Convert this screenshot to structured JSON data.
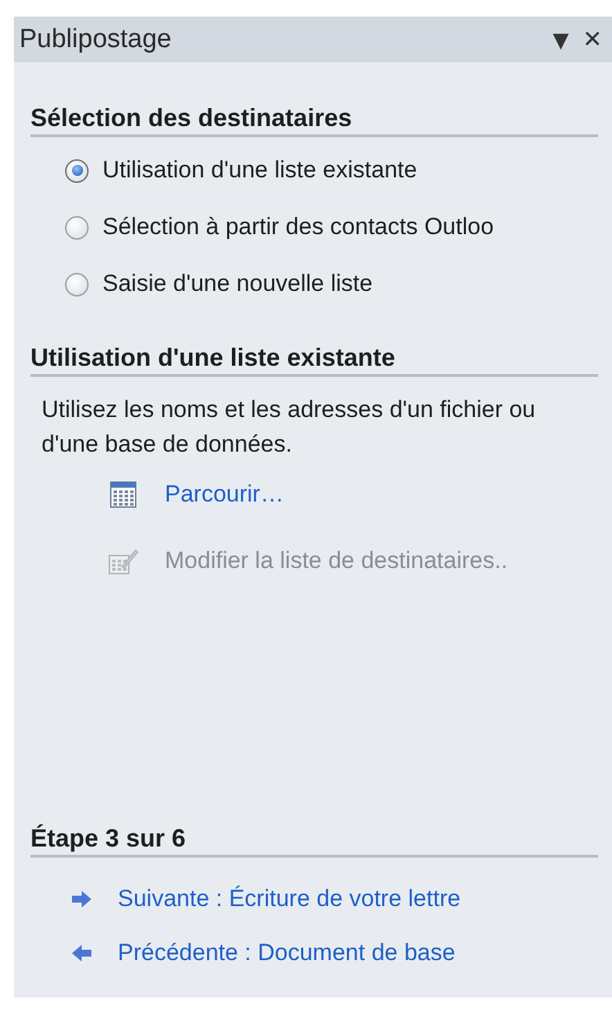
{
  "panel": {
    "title": "Publipostage",
    "menu_glyph": "▼",
    "close_glyph": "✕"
  },
  "recipients": {
    "heading": "Sélection des destinataires",
    "options": [
      {
        "label": "Utilisation d'une liste existante",
        "selected": true
      },
      {
        "label": "Sélection à partir des contacts Outloo",
        "selected": false
      },
      {
        "label": "Saisie d'une nouvelle liste",
        "selected": false
      }
    ]
  },
  "existing_list": {
    "heading": "Utilisation d'une liste existante",
    "description": "Utilisez les noms et les adresses d'un fichier ou d'une base de données.",
    "actions": [
      {
        "kind": "browse",
        "label": "Parcourir…",
        "disabled": false
      },
      {
        "kind": "edit",
        "label": "Modifier la liste de destinataires..",
        "disabled": true
      }
    ]
  },
  "step": {
    "heading": "Étape 3 sur 6",
    "links": [
      {
        "kind": "next",
        "label": "Suivante : Écriture de votre lettre"
      },
      {
        "kind": "previous",
        "label": "Précédente : Document de base"
      }
    ]
  }
}
